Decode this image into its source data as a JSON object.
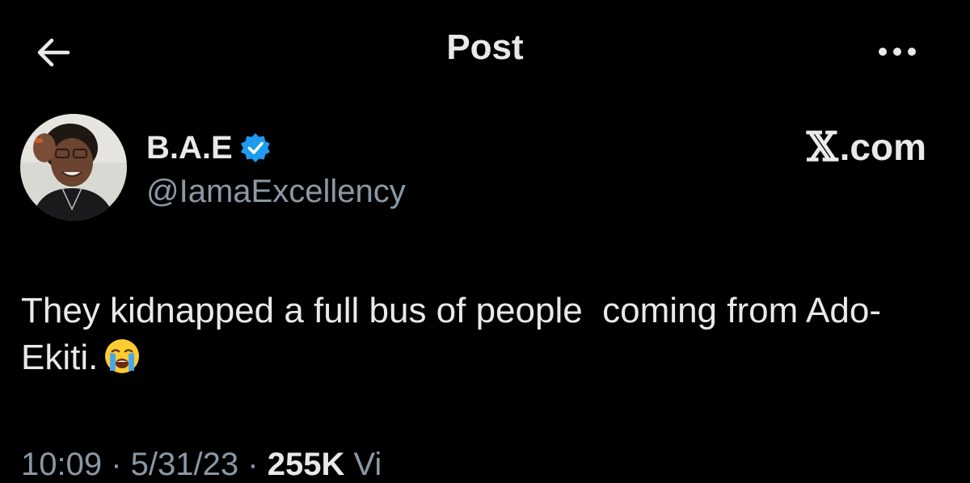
{
  "header": {
    "title": "Post",
    "back_icon": "arrow-left-icon",
    "more_icon": "more-horizontal-icon"
  },
  "author": {
    "display_name": "B.A.E",
    "handle": "@IamaExcellency",
    "verified": true,
    "verified_icon": "verified-badge-icon",
    "verified_color": "#1d9bf0"
  },
  "watermark": {
    "x": "𝕏",
    "suffix": ".com"
  },
  "post": {
    "text": "They kidnapped a full bus of people  coming from Ado-Ekiti.",
    "emoji_icon": "loudly-crying-face-icon"
  },
  "meta": {
    "time": "10:09",
    "date": "5/31/23",
    "views_count": "255K",
    "views_label": "Vi"
  },
  "colors": {
    "background": "#000000",
    "text": "#e7e9ea",
    "secondary_text": "#8b98a5"
  }
}
